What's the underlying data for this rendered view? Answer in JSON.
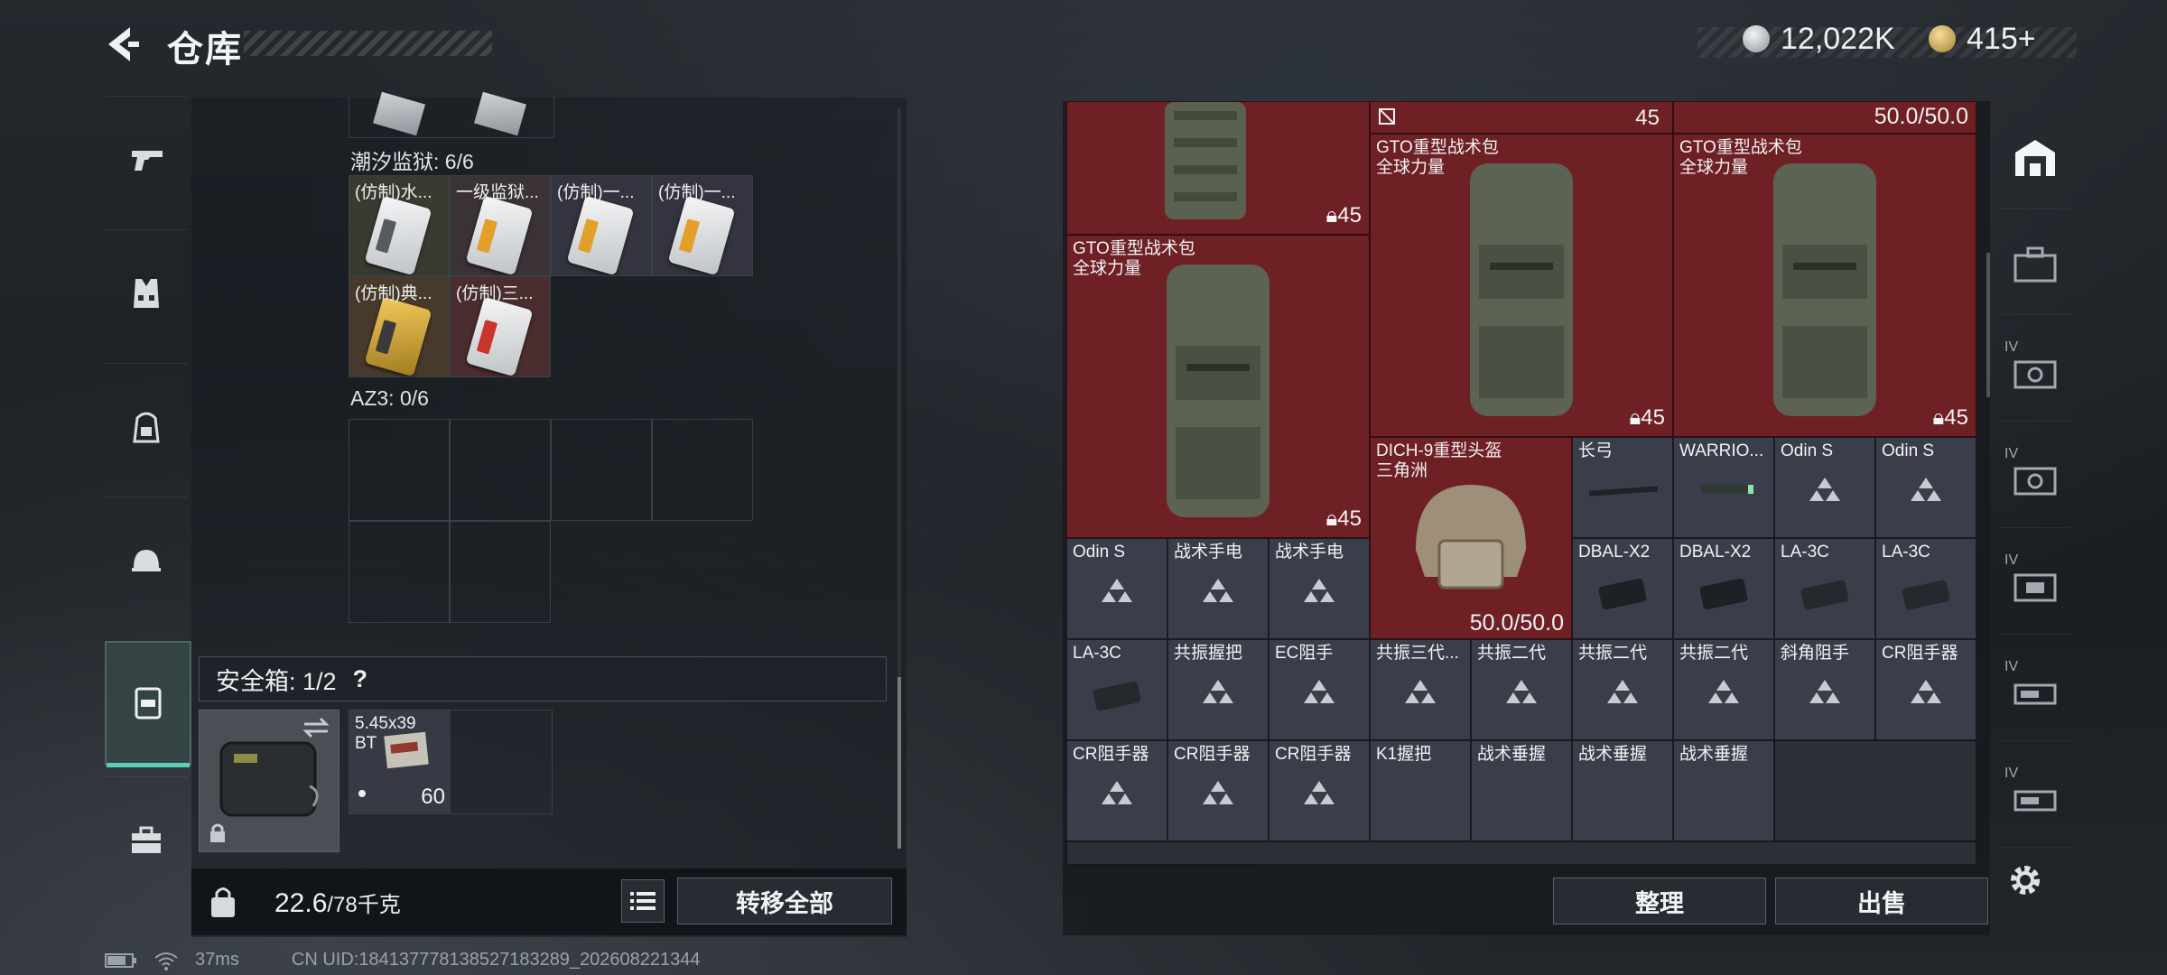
{
  "header": {
    "title": "仓库",
    "currency_silver": "12,022K",
    "currency_gold": "415+",
    "colors": {
      "silver": "#b9bec4",
      "gold": "#d8b25a"
    }
  },
  "left_nav": {
    "items": [
      "pistol-icon",
      "vest-icon",
      "backpack-icon",
      "helmet-icon",
      "safe-box-icon",
      "toolbox-icon"
    ],
    "active": "safe-box-icon",
    "accent": "#59d1b6"
  },
  "left_panel": {
    "section1": {
      "label": "潮汐监狱: 6/6",
      "items": [
        "(仿制)水...",
        "一级监狱...",
        "(仿制)一...",
        "(仿制)一...",
        "(仿制)典...",
        "(仿制)三..."
      ]
    },
    "section2": {
      "label": "AZ3: 0/6"
    },
    "safe_box": {
      "label": "安全箱: 1/2",
      "help": "?"
    },
    "ammo": {
      "name_line1": "5.45x39",
      "name_line2": "BT",
      "count": "60"
    },
    "weight": {
      "value": "22.6",
      "unit": "/78千克"
    },
    "transfer_all": "转移全部"
  },
  "right_panel": {
    "top_row": {
      "count": "45",
      "durability": "50.0/50.0"
    },
    "backpacks": [
      {
        "name": "GTO重型战术包",
        "sub": "全球力量",
        "count": "45"
      },
      {
        "name": "GTO重型战术包",
        "sub": "全球力量",
        "count": "45"
      },
      {
        "name": "GTO重型战术包",
        "sub": "全球力量",
        "count": "45"
      }
    ],
    "backpack_top_left_count": "45",
    "helmet": {
      "name": "DICH-9重型头盔",
      "sub": "三角洲",
      "durability": "50.0/50.0"
    },
    "items_row1": [
      "长弓",
      "WARRIO...",
      "Odin S",
      "Odin S"
    ],
    "items_row2a": [
      "Odin S",
      "战术手电",
      "战术手电"
    ],
    "items_row2b": [
      "DBAL-X2",
      "DBAL-X2",
      "LA-3C",
      "LA-3C"
    ],
    "items_row3": [
      "LA-3C",
      "共振握把",
      "EC阻手",
      "共振三代...",
      "共振二代",
      "共振二代",
      "共振二代",
      "斜角阻手",
      "CR阻手器"
    ],
    "items_row4": [
      "CR阻手器",
      "CR阻手器",
      "CR阻手器",
      "K1握把",
      "战术垂握",
      "战术垂握",
      "战术垂握"
    ],
    "sort_button": "整理",
    "sell_button": "出售",
    "colors": {
      "red_cell": "#6e2025",
      "gray_cell": "#3b3d4a"
    }
  },
  "right_nav": {
    "items": [
      "warehouse-icon",
      "case-icon",
      "iv-case-icon",
      "iv-case-icon",
      "iv-case-icon",
      "iv-case-icon",
      "iv-case-icon"
    ],
    "badge": "IV"
  },
  "status_bar": {
    "ping": "37ms",
    "uid": "CN UID:18413777813852718328​9_202608221344"
  }
}
